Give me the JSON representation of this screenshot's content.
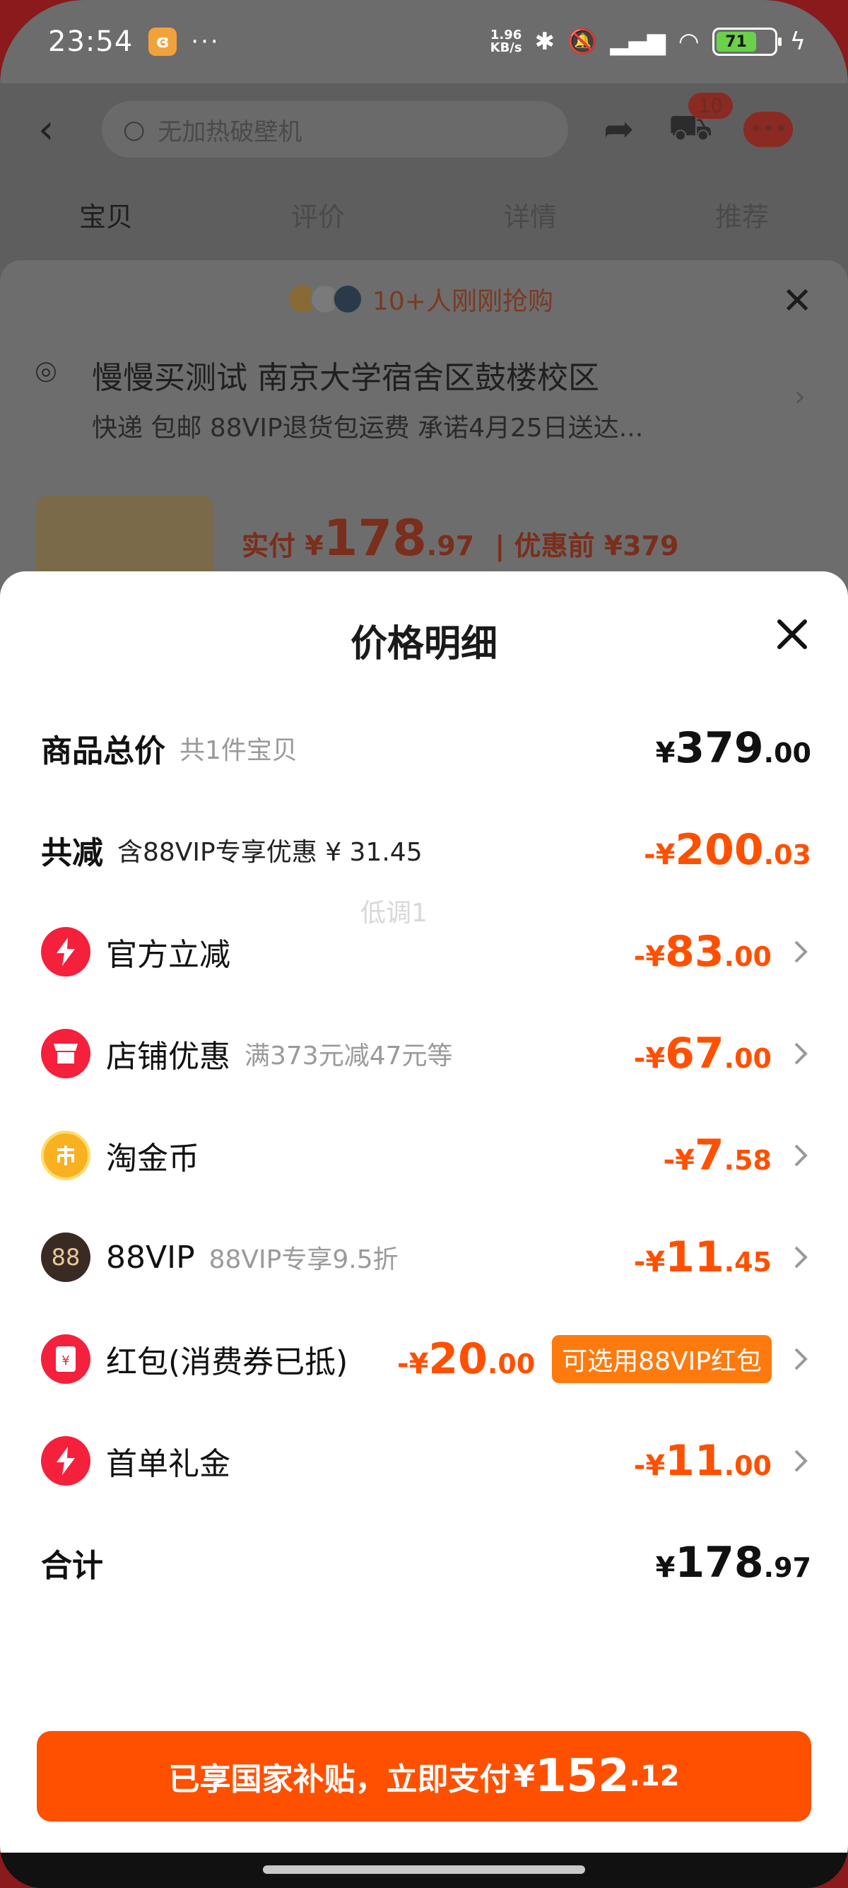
{
  "status_bar": {
    "time": "23:54",
    "app_badge": "ɞ",
    "more": "···",
    "net_speed_value": "1.96",
    "net_speed_unit": "KB/s",
    "battery": "71"
  },
  "background_page": {
    "search_placeholder": "无加热破壁机",
    "cart_badge": "10",
    "tabs": [
      "宝贝",
      "评价",
      "详情",
      "推荐"
    ],
    "buyers_text": "10+人刚刚抢购",
    "address_line1": "慢慢买测试 南京大学宿舍区鼓楼校区",
    "address_line2": "快递 包邮 88VIP退货包运费 承诺4月25日送达...",
    "price_prefix": "实付 ¥",
    "price_int": "178",
    "price_dec": ".97",
    "price_before": "| 优惠前 ¥379"
  },
  "modal": {
    "title": "价格明细",
    "rows": {
      "total": {
        "label": "商品总价",
        "sub": "共1件宝贝",
        "cur": "¥",
        "int": "379",
        "dec": ".00"
      },
      "discount": {
        "label": "共减",
        "sub": "含88VIP专享优惠 ¥ 31.45",
        "cur": "-¥",
        "int": "200",
        "dec": ".03"
      },
      "official": {
        "label": "官方立减",
        "cur": "-¥",
        "int": "83",
        "dec": ".00"
      },
      "shop": {
        "label": "店铺优惠",
        "sub": "满373元减47元等",
        "cur": "-¥",
        "int": "67",
        "dec": ".00"
      },
      "coin": {
        "label": "淘金币",
        "cur": "-¥",
        "int": "7",
        "dec": ".58"
      },
      "vip": {
        "label": "88VIP",
        "sub": "88VIP专享9.5折",
        "icon_text": "88",
        "cur": "-¥",
        "int": "11",
        "dec": ".45"
      },
      "redpacket": {
        "label": "红包(消费券已抵)",
        "cur": "-¥",
        "int": "20",
        "dec": ".00",
        "button": "可选用88VIP红包"
      },
      "firstorder": {
        "label": "首单礼金",
        "cur": "-¥",
        "int": "11",
        "dec": ".00"
      },
      "sum": {
        "label": "合计",
        "cur": "¥",
        "int": "178",
        "dec": ".97"
      }
    },
    "faint_text": "低调1",
    "pay_button": {
      "text": "已享国家补贴，立即支付",
      "cur": "¥",
      "int": "152",
      "dec": ".12"
    }
  }
}
